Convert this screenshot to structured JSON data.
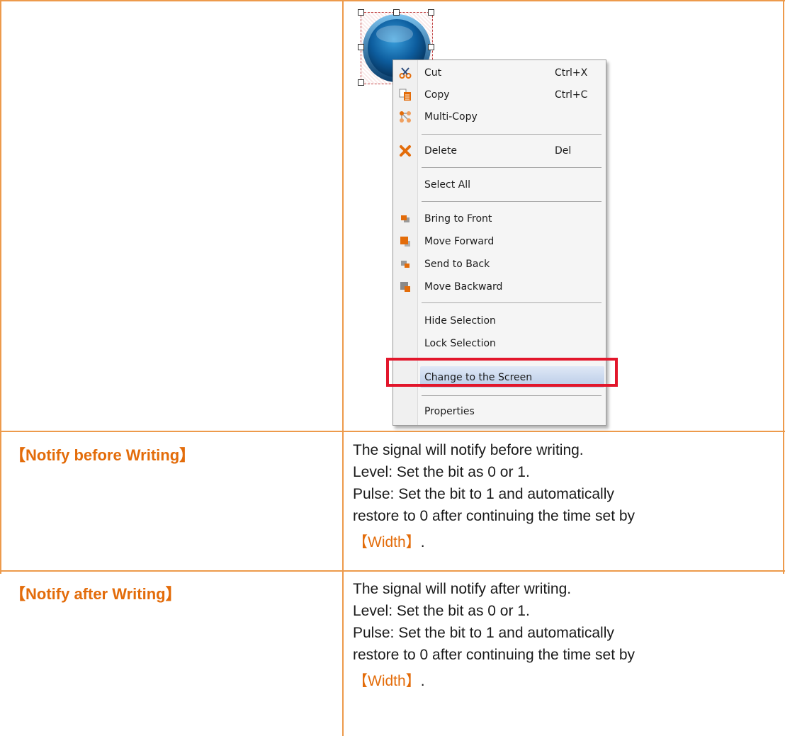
{
  "menu": {
    "items": [
      {
        "label": "Cut",
        "shortcut": "Ctrl+X",
        "icon": "scissors-icon"
      },
      {
        "label": "Copy",
        "shortcut": "Ctrl+C",
        "icon": "copy-icon"
      },
      {
        "label": "Multi-Copy",
        "shortcut": "",
        "icon": "multi-copy-icon"
      },
      {
        "label": "Delete",
        "shortcut": "Del",
        "icon": "delete-x-icon"
      },
      {
        "label": "Select All",
        "shortcut": "",
        "icon": ""
      },
      {
        "label": "Bring to Front",
        "shortcut": "",
        "icon": "bring-to-front-icon"
      },
      {
        "label": "Move Forward",
        "shortcut": "",
        "icon": "move-forward-icon"
      },
      {
        "label": "Send to Back",
        "shortcut": "",
        "icon": "send-to-back-icon"
      },
      {
        "label": "Move Backward",
        "shortcut": "",
        "icon": "move-backward-icon"
      },
      {
        "label": "Hide Selection",
        "shortcut": "",
        "icon": ""
      },
      {
        "label": "Lock Selection",
        "shortcut": "",
        "icon": ""
      },
      {
        "label": "Change to the Screen",
        "shortcut": "",
        "icon": ""
      },
      {
        "label": "Properties",
        "shortcut": "",
        "icon": ""
      }
    ]
  },
  "rows": [
    {
      "label": "【Notify before Writing】",
      "desc": {
        "line1": "The signal will notify before writing.",
        "line2": "Level: Set the bit as 0 or 1.",
        "line3": "Pulse: Set the bit to 1 and automatically",
        "line4": "restore to 0 after continuing the time set by",
        "line5_ref": "【Width】",
        "line5_end": "."
      }
    },
    {
      "label": "【Notify after Writing】",
      "desc": {
        "line1": "The signal will notify after writing.",
        "line2": "Level: Set the bit as 0 or 1.",
        "line3": "Pulse: Set the bit to 1 and automatically",
        "line4": "restore to 0 after continuing the time set by",
        "line5_ref": "【Width】",
        "line5_end": "."
      }
    }
  ]
}
